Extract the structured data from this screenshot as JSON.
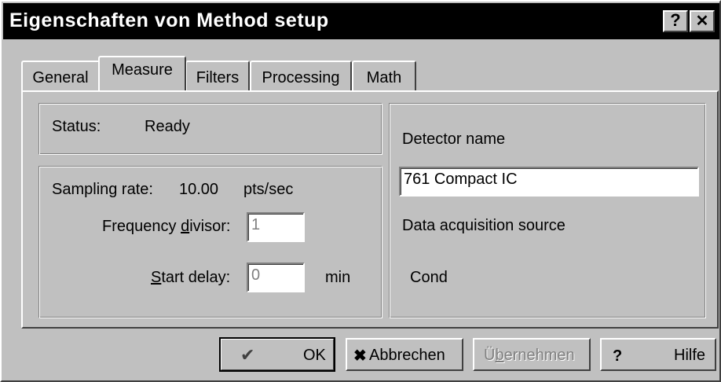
{
  "window": {
    "title": "Eigenschaften von Method setup",
    "help_glyph": "?",
    "close_glyph": "✕"
  },
  "tabs": [
    {
      "label": "General",
      "active": false
    },
    {
      "label": "Measure",
      "active": true
    },
    {
      "label": "Filters",
      "active": false
    },
    {
      "label": "Processing",
      "active": false
    },
    {
      "label": "Math",
      "active": false
    }
  ],
  "status": {
    "label": "Status:",
    "value": "Ready"
  },
  "sampling": {
    "rate_label": "Sampling rate:",
    "rate_value": "10.00",
    "rate_unit": "pts/sec",
    "divisor_label_pre": "Frequency ",
    "divisor_label_ul": "d",
    "divisor_label_post": "ivisor:",
    "divisor_value": "1",
    "delay_label_ul": "S",
    "delay_label_post": "tart delay:",
    "delay_value": "0",
    "delay_unit": "min"
  },
  "detector": {
    "name_label": "Detector name",
    "name_value": "761 Compact IC",
    "source_label": "Data acquisition source",
    "source_value": "Cond"
  },
  "buttons": {
    "ok": "OK",
    "cancel": "Abbrechen",
    "apply_ul": "b",
    "apply_pre": "Ü",
    "apply_post": "ernehmen",
    "help": "Hilfe"
  },
  "icons": {
    "ok": "check-icon",
    "cancel": "x-icon",
    "help": "question-icon"
  },
  "colors": {
    "titlebar": "#000000",
    "face": "#c0c0c0",
    "field": "#ffffff"
  }
}
